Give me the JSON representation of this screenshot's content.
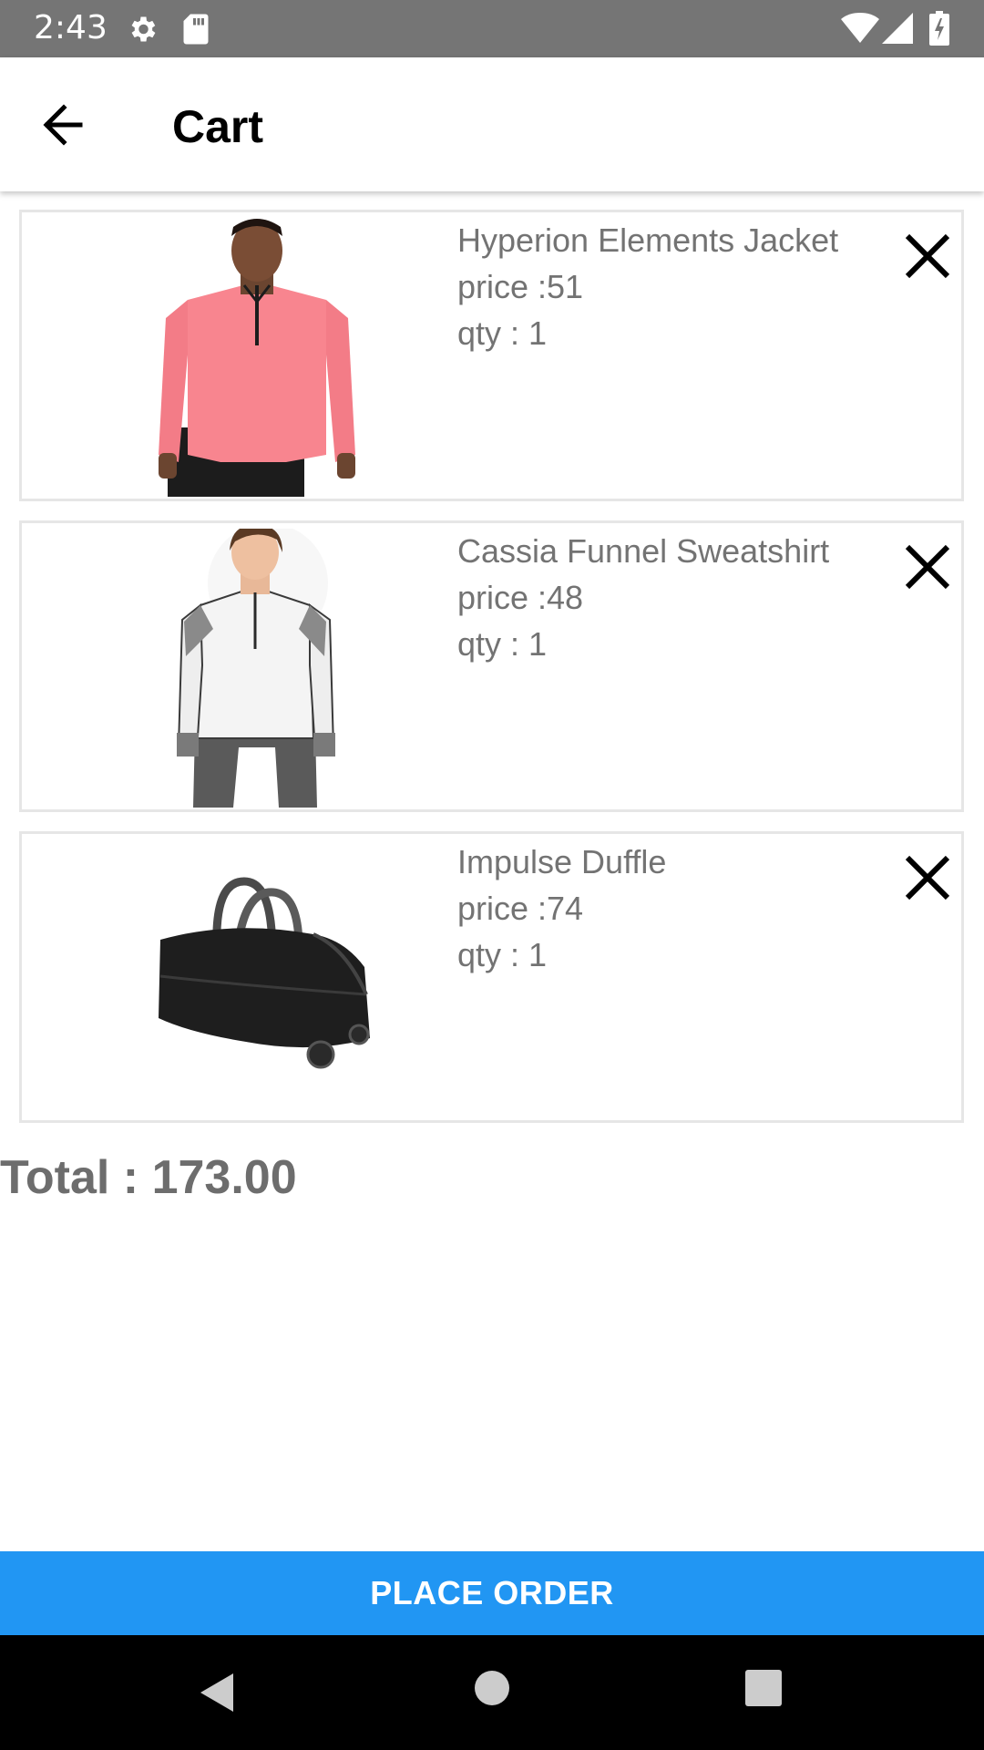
{
  "status_bar": {
    "time": "2:43",
    "icons": [
      "gear-icon",
      "sd-card-icon",
      "wifi-icon",
      "signal-icon",
      "battery-charging-icon"
    ]
  },
  "app_bar": {
    "title": "Cart",
    "back_icon": "arrow-back-icon"
  },
  "cart": {
    "items": [
      {
        "name": "Hyperion Elements Jacket",
        "price": "price :51",
        "qty": "qty : 1",
        "image": "pink-jacket-photo"
      },
      {
        "name": "Cassia Funnel Sweatshirt",
        "price": "price :48",
        "qty": "qty : 1",
        "image": "white-sweatshirt-photo"
      },
      {
        "name": "Impulse Duffle",
        "price": "price :74",
        "qty": "qty : 1",
        "image": "black-duffle-bag-photo"
      }
    ],
    "remove_icon": "close-icon"
  },
  "total": "Total : 173.00",
  "place_order_label": "PLACE ORDER",
  "colors": {
    "status_bar": "#757575",
    "accent": "#2196f3",
    "item_text": "#737373",
    "total_text": "#6d6d6d"
  }
}
